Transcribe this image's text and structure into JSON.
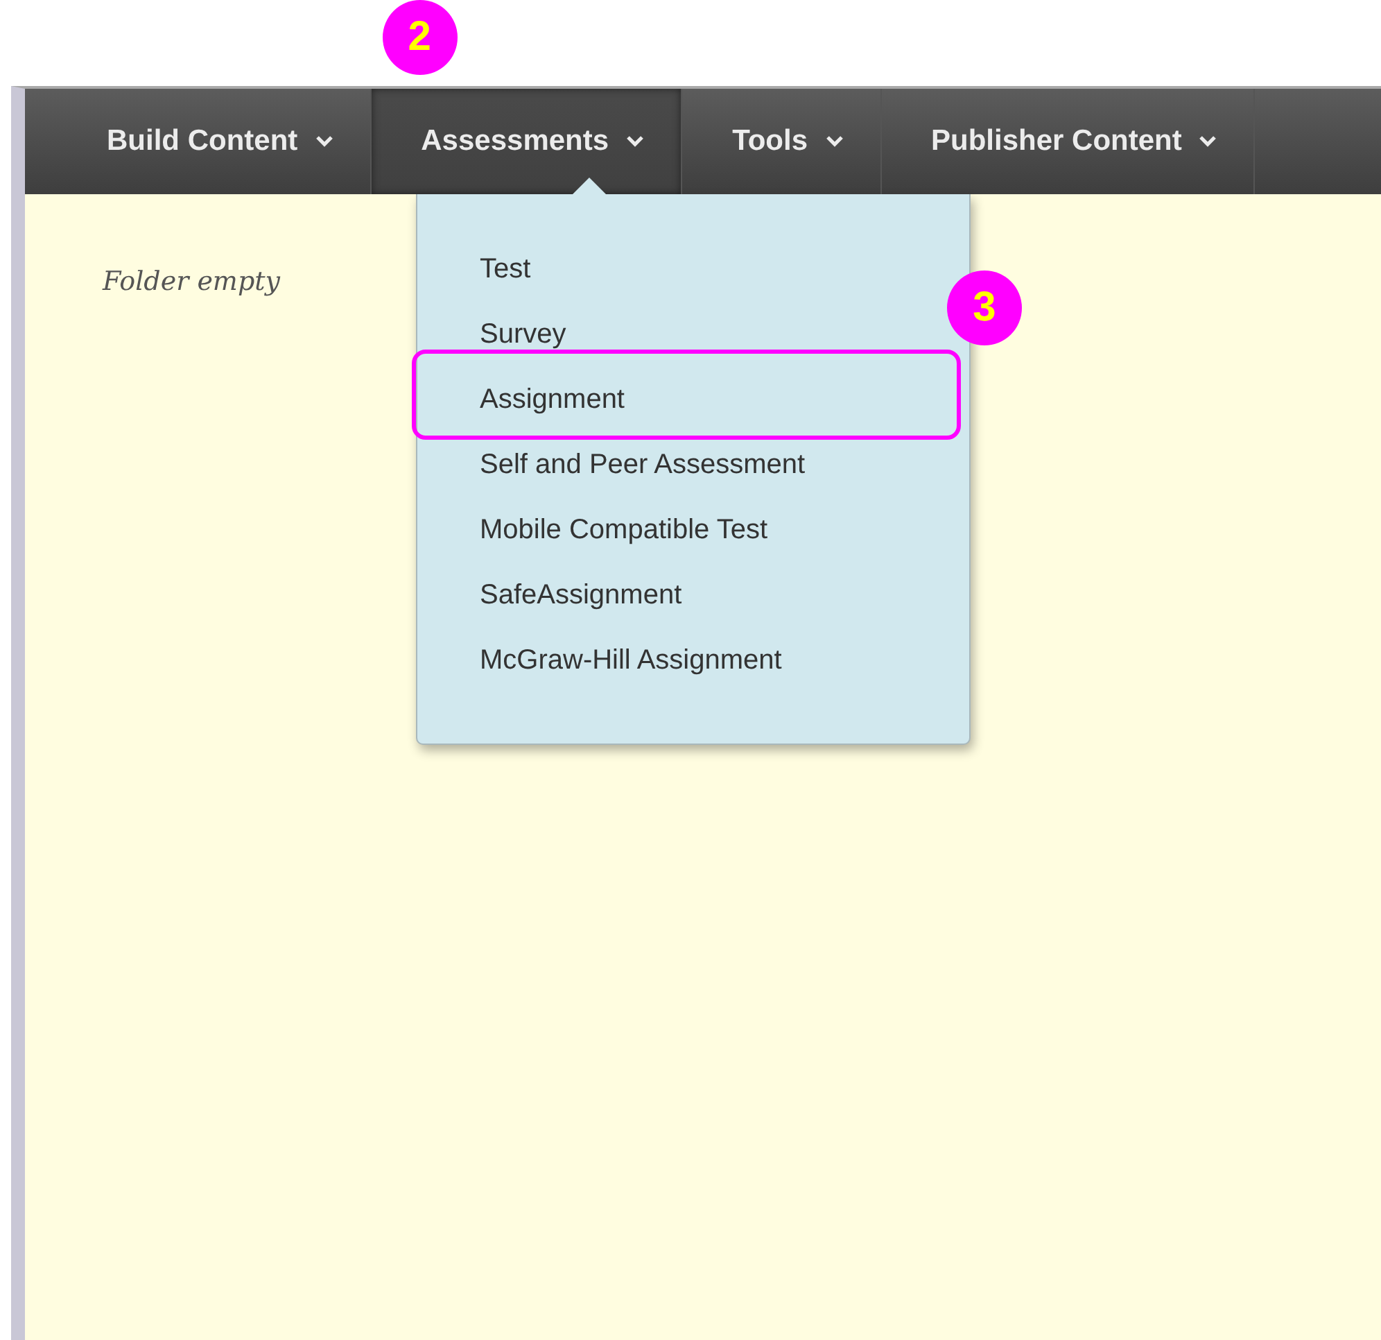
{
  "nav": {
    "tabs": [
      {
        "label": "Build Content",
        "selected": false
      },
      {
        "label": "Assessments",
        "selected": true,
        "callout": "2"
      },
      {
        "label": "Tools",
        "selected": false
      },
      {
        "label": "Publisher Content",
        "selected": false
      }
    ]
  },
  "menu": {
    "items": [
      {
        "label": "Test",
        "highlighted": false
      },
      {
        "label": "Survey",
        "highlighted": false
      },
      {
        "label": "Assignment",
        "highlighted": true,
        "callout": "3"
      },
      {
        "label": "Self and Peer Assessment",
        "highlighted": false
      },
      {
        "label": "Mobile Compatible Test",
        "highlighted": false
      },
      {
        "label": "SafeAssignment",
        "highlighted": false
      },
      {
        "label": "McGraw-Hill Assignment",
        "highlighted": false
      }
    ]
  },
  "content": {
    "empty_message": "Folder empty"
  }
}
